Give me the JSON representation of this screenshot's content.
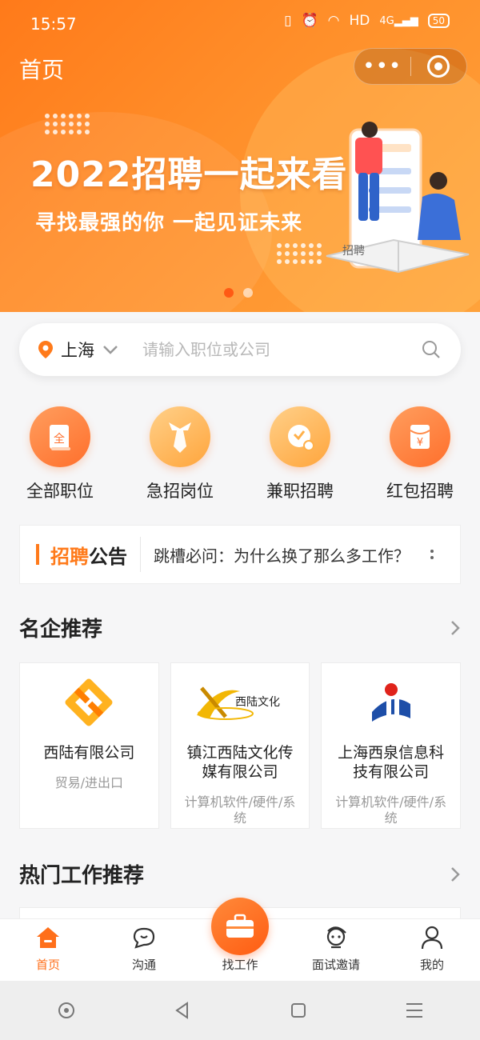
{
  "status": {
    "time": "15:57",
    "network": "HD",
    "signal": "4G",
    "battery": "50"
  },
  "nav": {
    "title": "首页"
  },
  "banner": {
    "title": "2022招聘一起来看",
    "subtitle": "寻找最强的你 一起见证未来",
    "book_label": "招聘"
  },
  "search": {
    "city": "上海",
    "placeholder": "请输入职位或公司"
  },
  "categories": [
    {
      "label": "全部职位",
      "icon": "document-icon",
      "glyph": "全"
    },
    {
      "label": "急招岗位",
      "icon": "tie-icon"
    },
    {
      "label": "兼职招聘",
      "icon": "clock-icon"
    },
    {
      "label": "红包招聘",
      "icon": "red-envelope-icon",
      "glyph": "¥"
    }
  ],
  "notice": {
    "title_highlight": "招聘",
    "title_rest": "公告",
    "text": "跳槽必问：为什么换了那么多工作？"
  },
  "sections": {
    "companies_title": "名企推荐",
    "hot_jobs_title": "热门工作推荐"
  },
  "companies": [
    {
      "name": "西陆有限公司",
      "category": "贸易/进出口"
    },
    {
      "name": "镇江西陆文化传媒有限公司",
      "category": "计算机软件/硬件/系统",
      "logo_text": "西陆文化"
    },
    {
      "name": "上海西泉信息科技有限公司",
      "category": "计算机软件/硬件/系统"
    }
  ],
  "tabs": [
    {
      "label": "首页",
      "active": true
    },
    {
      "label": "沟通",
      "active": false
    },
    {
      "label": "找工作",
      "active": false
    },
    {
      "label": "面试邀请",
      "active": false
    },
    {
      "label": "我的",
      "active": false
    }
  ],
  "colors": {
    "accent": "#ff7a1a",
    "accent_dark": "#ff5c12",
    "background": "#f6f6f7"
  }
}
